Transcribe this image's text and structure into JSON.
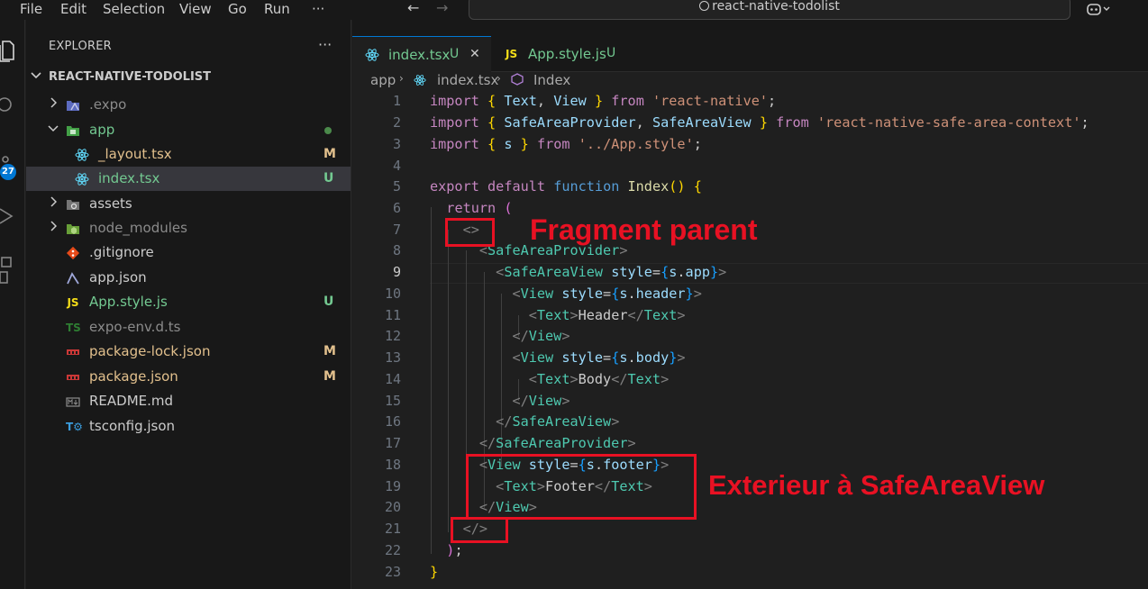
{
  "menu": {
    "items": [
      "File",
      "Edit",
      "Selection",
      "View",
      "Go",
      "Run"
    ],
    "more": "···"
  },
  "search": {
    "text": "react-native-todolist"
  },
  "activity": {
    "badge": "27"
  },
  "explorer": {
    "title": "EXPLORER",
    "more": "···",
    "project": "REACT-NATIVE-TODOLIST",
    "items": [
      {
        "name": ".expo",
        "status": "",
        "icon": "folder-expo-icon"
      },
      {
        "name": "app",
        "status": "",
        "icon": "folder-app-icon"
      },
      {
        "name": "_layout.tsx",
        "status": "M",
        "icon": "react-icon"
      },
      {
        "name": "index.tsx",
        "status": "U",
        "icon": "react-icon"
      },
      {
        "name": "assets",
        "status": "",
        "icon": "folder-assets-icon"
      },
      {
        "name": "node_modules",
        "status": "",
        "icon": "folder-node-icon"
      },
      {
        "name": ".gitignore",
        "status": "",
        "icon": "git-icon"
      },
      {
        "name": "app.json",
        "status": "",
        "icon": "expo-icon"
      },
      {
        "name": "App.style.js",
        "status": "U",
        "icon": "js-icon"
      },
      {
        "name": "expo-env.d.ts",
        "status": "",
        "icon": "ts-icon"
      },
      {
        "name": "package-lock.json",
        "status": "M",
        "icon": "npm-icon"
      },
      {
        "name": "package.json",
        "status": "M",
        "icon": "npm-icon"
      },
      {
        "name": "README.md",
        "status": "",
        "icon": "markdown-icon"
      },
      {
        "name": "tsconfig.json",
        "status": "",
        "icon": "tsconfig-icon"
      }
    ]
  },
  "tabs": [
    {
      "label": "index.tsx",
      "status": "U",
      "close": "✕"
    },
    {
      "icon_text": "JS",
      "label": "App.style.js",
      "status": "U"
    }
  ],
  "breadcrumb": {
    "folder": "app",
    "file": "index.tsx",
    "symbol": "Index"
  },
  "code": {
    "line_numbers": [
      "1",
      "2",
      "3",
      "4",
      "5",
      "6",
      "7",
      "8",
      "9",
      "10",
      "11",
      "12",
      "13",
      "14",
      "15",
      "16",
      "17",
      "18",
      "19",
      "20",
      "21",
      "22",
      "23"
    ],
    "active_line": "9"
  },
  "annotations": {
    "fragment": "Fragment parent",
    "exterior": "Exterieur à SafeAreaView"
  },
  "colors": {
    "accent": "#0078d4",
    "annotation": "#e81123",
    "untracked": "#73c991",
    "modified": "#e2c08d"
  }
}
